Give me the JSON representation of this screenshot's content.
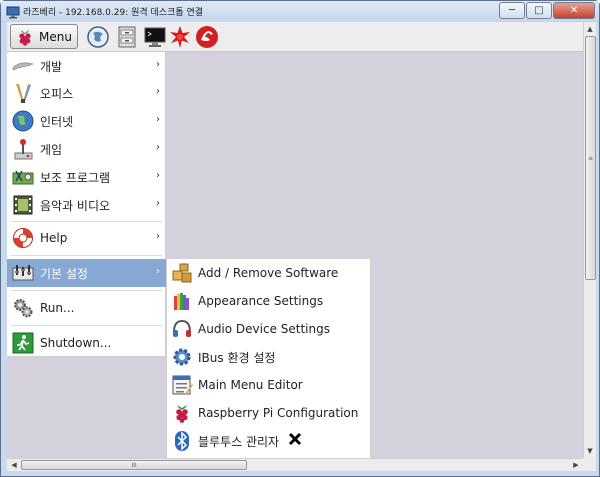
{
  "window": {
    "title": "라즈베리 - 192.168.0.29: 원격 데스크톱 연결",
    "controls": {
      "minimize": "─",
      "maximize": "□",
      "close": "✕"
    }
  },
  "taskbar": {
    "menu_label": "Menu",
    "launchers": [
      "web-browser-icon",
      "file-manager-icon",
      "terminal-icon",
      "wolfram-icon",
      "mathematica-icon"
    ]
  },
  "main_menu": {
    "items": [
      {
        "label": "개발",
        "icon": "programming-icon",
        "has_submenu": true
      },
      {
        "label": "오피스",
        "icon": "office-icon",
        "has_submenu": true
      },
      {
        "label": "인터넷",
        "icon": "internet-globe-icon",
        "has_submenu": true
      },
      {
        "label": "게임",
        "icon": "joystick-icon",
        "has_submenu": true
      },
      {
        "label": "보조 프로그램",
        "icon": "accessories-icon",
        "has_submenu": true
      },
      {
        "label": "음악과 비디오",
        "icon": "film-strip-icon",
        "has_submenu": true
      },
      {
        "label": "Help",
        "icon": "lifebuoy-icon",
        "has_submenu": true
      },
      {
        "label": "기본 설정",
        "icon": "preferences-icon",
        "has_submenu": true,
        "active": true
      },
      {
        "label": "Run...",
        "icon": "run-gears-icon",
        "has_submenu": false
      },
      {
        "label": "Shutdown...",
        "icon": "exit-icon",
        "has_submenu": false
      }
    ]
  },
  "submenu": {
    "items": [
      {
        "label": "Add / Remove Software",
        "icon": "package-icon"
      },
      {
        "label": "Appearance Settings",
        "icon": "color-palette-icon"
      },
      {
        "label": "Audio Device Settings",
        "icon": "headphones-icon"
      },
      {
        "label": "IBus 환경 설정",
        "icon": "gear-icon"
      },
      {
        "label": "Main Menu Editor",
        "icon": "menu-editor-icon"
      },
      {
        "label": "Raspberry Pi Configuration",
        "icon": "raspberry-icon"
      },
      {
        "label": "블루투스 관리자",
        "icon": "bluetooth-icon"
      }
    ]
  },
  "colors": {
    "menu_highlight": "#86a8d2",
    "desktop": "#d5d1dc"
  },
  "scroll": {
    "vertical_grip": "≡",
    "horizontal_grip": "III"
  }
}
